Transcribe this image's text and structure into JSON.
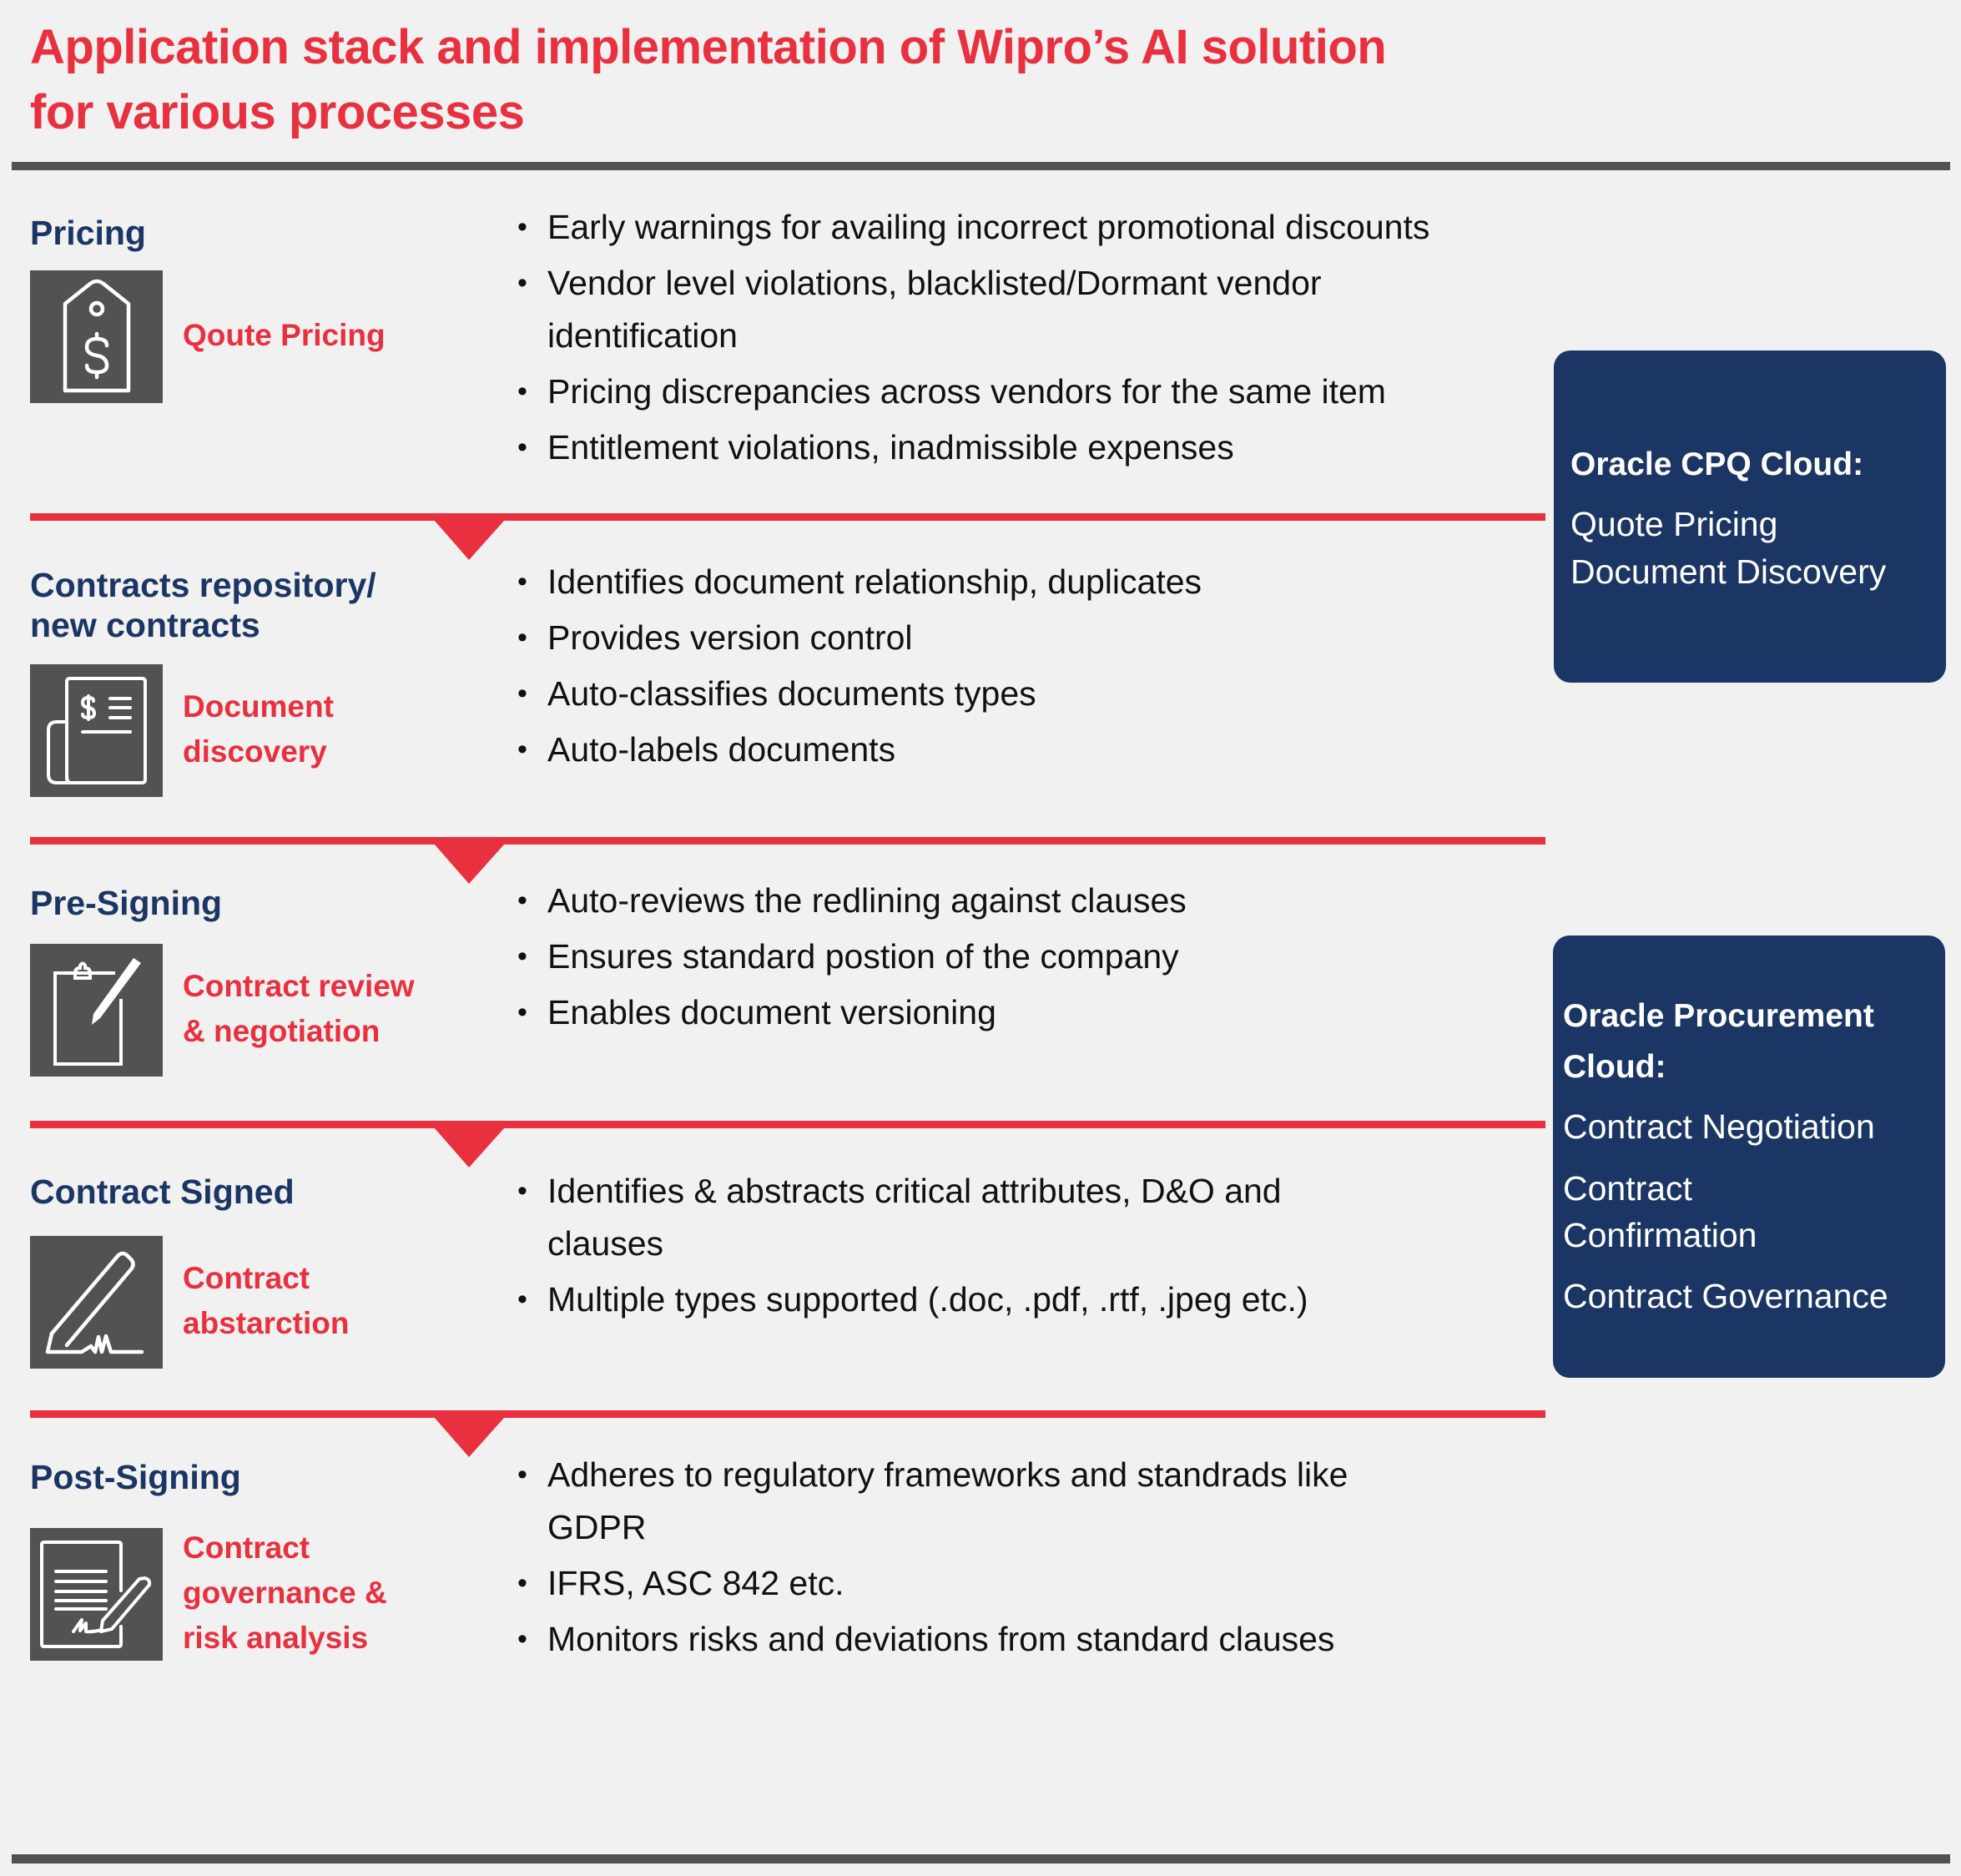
{
  "title": "Application stack and implementation of Wipro’s AI solution\nfor various processes",
  "colors": {
    "accent_red": "#e8303f",
    "navy": "#1b3664",
    "icon_box": "#525254",
    "background": "#f0f1f0"
  },
  "sections": [
    {
      "heading": "Pricing",
      "icon": "price-tag-dollar-icon",
      "label": "Qoute Pricing",
      "bullets": [
        "Early warnings for availing incorrect promotional discounts",
        "Vendor level violations, blacklisted/Dormant vendor\nidentification",
        "Pricing discrepancies across vendors for the same item",
        "Entitlement violations, inadmissible expenses"
      ]
    },
    {
      "heading": "Contracts repository/\nnew contracts",
      "icon": "document-scroll-dollar-icon",
      "label": "Document\ndiscovery",
      "bullets": [
        "Identifies document relationship, duplicates",
        "Provides version control",
        "Auto-classifies documents types",
        "Auto-labels documents"
      ]
    },
    {
      "heading": "Pre-Signing",
      "icon": "clipboard-pen-icon",
      "label": "Contract review\n& negotiation",
      "bullets": [
        "Auto-reviews the redlining against clauses",
        "Ensures standard postion of the company",
        "Enables document versioning"
      ]
    },
    {
      "heading": "Contract Signed",
      "icon": "pen-signature-icon",
      "label": "Contract\nabstarction",
      "bullets": [
        "Identifies & abstracts critical attributes, D&O and\nclauses",
        "Multiple types supported (.doc, .pdf, .rtf, .jpeg etc.)"
      ]
    },
    {
      "heading": "Post-Signing",
      "icon": "document-sign-pen-icon",
      "label": "Contract\ngovernance &\nrisk analysis",
      "bullets": [
        "Adheres to regulatory frameworks and standrads like\nGDPR",
        "IFRS, ASC 842 etc.",
        "Monitors risks and deviations from standard clauses"
      ]
    }
  ],
  "bullet_glyph": "•",
  "cloud_boxes": [
    {
      "title": "Oracle CPQ Cloud:",
      "items": [
        "Quote Pricing",
        "Document Discovery"
      ]
    },
    {
      "title": "Oracle Procurement\nCloud:",
      "items": [
        "Contract Negotiation",
        "Contract\nConfirmation",
        "Contract Governance"
      ]
    }
  ]
}
